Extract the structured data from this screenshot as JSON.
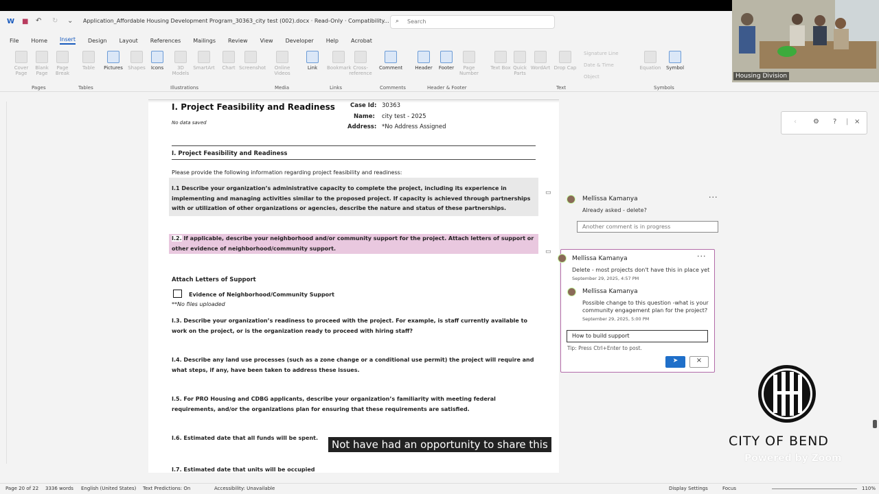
{
  "titlebar": {
    "doc_title": "Application_Affordable Housing Development Program_30363_city test (002).docx  ·  Read-Only  ·  Compatibility...",
    "search_placeholder": "Search"
  },
  "menu": [
    "File",
    "Home",
    "Insert",
    "Design",
    "Layout",
    "References",
    "Mailings",
    "Review",
    "View",
    "Developer",
    "Help",
    "Acrobat"
  ],
  "menu_active": "Insert",
  "ribbon": {
    "buttons": [
      {
        "label": "Cover Page",
        "state": "dim"
      },
      {
        "label": "Blank Page",
        "state": "dim"
      },
      {
        "label": "Page Break",
        "state": "dim"
      },
      {
        "label": "Table",
        "state": "dim"
      },
      {
        "label": "Pictures",
        "state": "on"
      },
      {
        "label": "Shapes",
        "state": "dim"
      },
      {
        "label": "Icons",
        "state": "on"
      },
      {
        "label": "3D Models",
        "state": "dim"
      },
      {
        "label": "SmartArt",
        "state": "dim"
      },
      {
        "label": "Chart",
        "state": "dim"
      },
      {
        "label": "Screenshot",
        "state": "dim"
      },
      {
        "label": "Online Videos",
        "state": "dim"
      },
      {
        "label": "Link",
        "state": "on"
      },
      {
        "label": "Bookmark",
        "state": "dim"
      },
      {
        "label": "Cross-reference",
        "state": "dim"
      },
      {
        "label": "Comment",
        "state": "on"
      },
      {
        "label": "Header",
        "state": "on"
      },
      {
        "label": "Footer",
        "state": "on"
      },
      {
        "label": "Page Number",
        "state": "dim"
      },
      {
        "label": "Text Box",
        "state": "dim"
      },
      {
        "label": "Quick Parts",
        "state": "dim"
      },
      {
        "label": "WordArt",
        "state": "dim"
      },
      {
        "label": "Drop Cap",
        "state": "dim"
      },
      {
        "label": "Equation",
        "state": "dim"
      },
      {
        "label": "Symbol",
        "state": "on"
      }
    ],
    "small_items": [
      "Signature Line",
      "Date & Time",
      "Object"
    ],
    "groups": [
      "Pages",
      "Tables",
      "Illustrations",
      "Media",
      "Links",
      "Comments",
      "Header & Footer",
      "Text",
      "Symbols"
    ]
  },
  "document": {
    "heading": "I. Project Feasibility and Readiness",
    "no_data": "No data saved",
    "case_id_label": "Case Id:",
    "case_id": "30363",
    "name_label": "Name:",
    "name": "city test - 2025",
    "address_label": "Address:",
    "address": "*No Address Assigned",
    "section_title": "I. Project Feasibility and Readiness",
    "intro": "Please provide the following information regarding project feasibility and readiness:",
    "q1": "I.1 Describe your organization’s administrative capacity to complete the project, including its experience in implementing and managing activities similar to the proposed project. If capacity is achieved through partnerships with or utilization of other organizations or agencies, describe the nature and status of these partnerships.",
    "q2_num": "I.2.",
    "q2": "If applicable, describe your neighborhood and/or community support for the project. Attach letters of support or other evidence of neighborhood/community support.",
    "attach_title": "Attach Letters of Support",
    "evidence_label": "Evidence of Neighborhood/Community Support",
    "no_files": "**No files uploaded",
    "q3": "I.3. Describe your organization’s readiness to proceed with the project. For example, is staff currently available to work on the project, or is the organization ready to proceed with hiring staff?",
    "q4": "I.4. Describe any land use processes (such as a zone change or a conditional use permit) the project will require and what steps, if any, have been taken to address these issues.",
    "q5": "I.5. For PRO Housing and CDBG applicants, describe your organization’s familiarity with meeting federal requirements, and/or the organizations plan for ensuring that these requirements are satisfied.",
    "q6": "I.6. Estimated date that all funds will be spent.",
    "q7": "I.7. Estimated date that units will be occupied"
  },
  "caption": "Not have had an opportunity to share this",
  "comments": {
    "thread1": {
      "author": "Mellissa Kamanya",
      "text": "Already asked - delete?",
      "reply_placeholder": "Another comment is in progress"
    },
    "thread2": {
      "author": "Mellissa Kamanya",
      "text": "Delete - most projects don't have this in place yet",
      "date": "September 29, 2025, 4:57 PM",
      "reply_author": "Mellissa Kamanya",
      "reply_text_1": "Possible change to this question -what is your",
      "reply_text_2": "community engagement plan for the project?",
      "reply_date": "September 29, 2025, 5:00 PM",
      "input_value": "How to build support",
      "tip": "Tip: Press Ctrl+Enter to post."
    }
  },
  "video": {
    "participant_label": "Housing Division"
  },
  "branding": {
    "city": "CITY OF BEND",
    "powered": "Powered by Zoom"
  },
  "status": {
    "page": "Page 20 of 22",
    "words": "3336 words",
    "language": "English (United States)",
    "predictions": "Text Predictions: On",
    "accessibility": "Accessibility: Unavailable",
    "display": "Display Settings",
    "focus": "Focus",
    "zoom": "110%"
  },
  "colors": {
    "accent": "#185abd",
    "comment_border": "#b26aa8",
    "highlight_pink": "#e9c8df",
    "highlight_grey": "#e8e8e8"
  }
}
